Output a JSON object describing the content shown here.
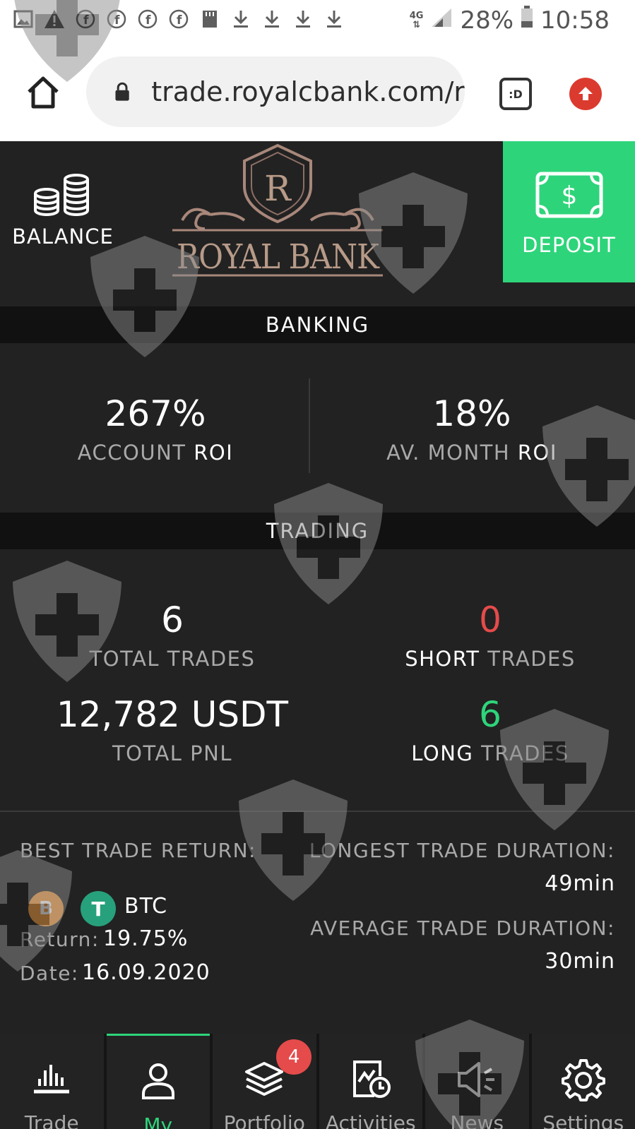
{
  "status_bar": {
    "network": "4G",
    "battery": "28%",
    "time": "10:58"
  },
  "browser": {
    "url": "trade.royalcbank.com/r",
    "tab_label": ":D"
  },
  "header": {
    "balance_label": "BALANCE",
    "logo_text": "ROYAL BANK",
    "logo_letter": "R",
    "deposit_label": "DEPOSIT"
  },
  "banking": {
    "section_title": "BANKING",
    "account_roi": {
      "value": "267%",
      "label_prefix": "ACCOUNT ",
      "label_highlight": "ROI"
    },
    "month_roi": {
      "value": "18%",
      "label_prefix": "AV. MONTH ",
      "label_highlight": "ROI"
    }
  },
  "trading": {
    "section_title": "TRADING",
    "total_trades": {
      "value": "6",
      "label": "TOTAL TRADES"
    },
    "short_trades": {
      "value": "0",
      "label_highlight": "SHORT",
      "label_suffix": " TRADES"
    },
    "total_pnl": {
      "value": "12,782 USDT",
      "label": "TOTAL PNL"
    },
    "long_trades": {
      "value": "6",
      "label_highlight": "LONG",
      "label_suffix": " TRADES"
    }
  },
  "details": {
    "best_trade_label": "BEST TRADE RETURN:",
    "coin_name": "BTC",
    "coin_badge_1": "B",
    "coin_badge_2": "T",
    "return_label": "Return:",
    "return_value": "19.75%",
    "date_label": "Date:",
    "date_value": "16.09.2020",
    "longest_label": "LONGEST TRADE DURATION:",
    "longest_value": "49min",
    "average_label": "AVERAGE TRADE DURATION:",
    "average_value": "30min"
  },
  "nav": {
    "items": [
      {
        "label": "Trade",
        "icon": "chart-bars-icon"
      },
      {
        "label": "My",
        "icon": "user-icon",
        "active": true
      },
      {
        "label": "Portfolio",
        "icon": "layers-icon",
        "badge": "4"
      },
      {
        "label": "Activities",
        "icon": "activity-clock-icon"
      },
      {
        "label": "News",
        "icon": "megaphone-icon"
      },
      {
        "label": "Settings",
        "icon": "gear-icon"
      }
    ]
  },
  "colors": {
    "accent_green": "#2ed47a",
    "accent_red": "#e54b4b",
    "background": "#222222",
    "section_bar": "#111111"
  }
}
